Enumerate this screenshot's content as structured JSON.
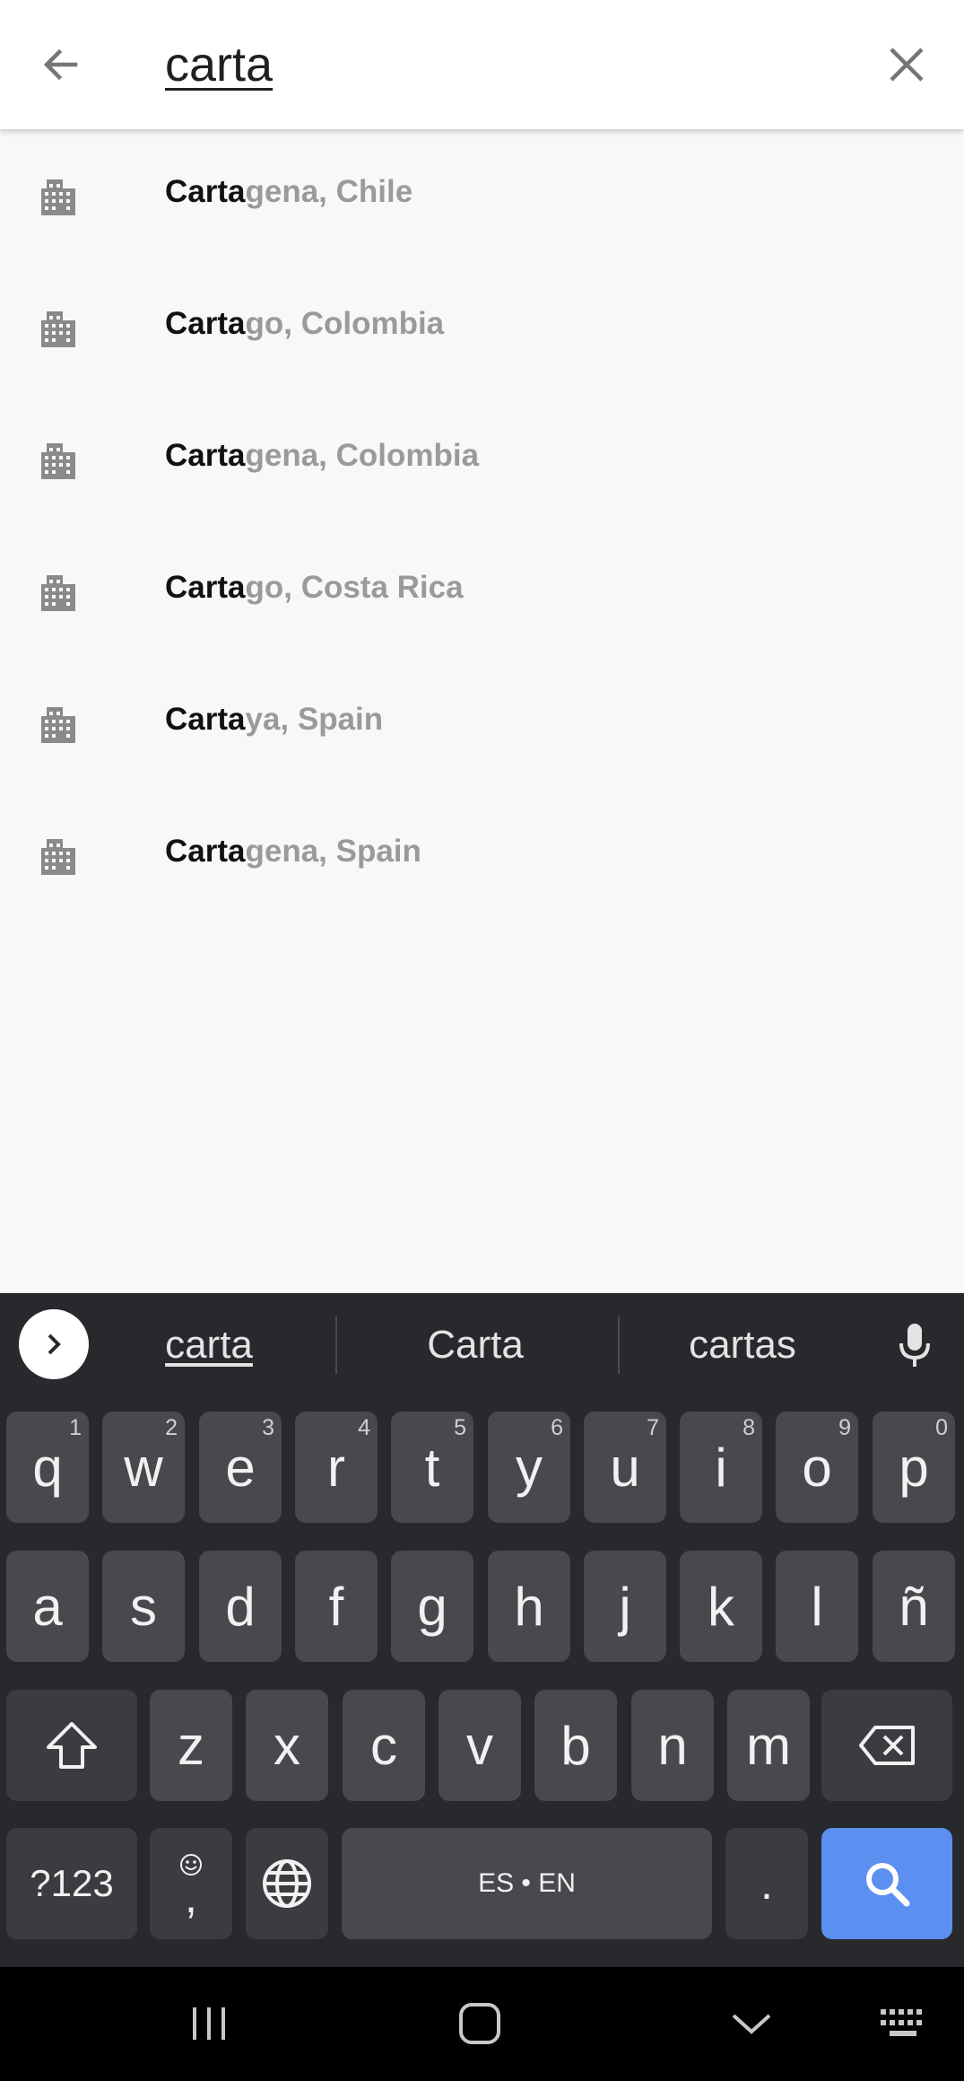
{
  "search": {
    "query": "carta",
    "back_icon": "arrow-left-icon",
    "clear_icon": "close-icon"
  },
  "results": [
    {
      "match": "Carta",
      "rest": "gena, Chile",
      "icon": "city-buildings-icon"
    },
    {
      "match": "Carta",
      "rest": "go, Colombia",
      "icon": "city-buildings-icon"
    },
    {
      "match": "Carta",
      "rest": "gena, Colombia",
      "icon": "city-buildings-icon"
    },
    {
      "match": "Carta",
      "rest": "go, Costa Rica",
      "icon": "city-buildings-icon"
    },
    {
      "match": "Carta",
      "rest": "ya, Spain",
      "icon": "city-buildings-icon"
    },
    {
      "match": "Carta",
      "rest": "gena, Spain",
      "icon": "city-buildings-icon"
    }
  ],
  "keyboard": {
    "suggestions": [
      "carta",
      "Carta",
      "cartas"
    ],
    "row1": [
      {
        "key": "q",
        "hint": "1"
      },
      {
        "key": "w",
        "hint": "2"
      },
      {
        "key": "e",
        "hint": "3"
      },
      {
        "key": "r",
        "hint": "4"
      },
      {
        "key": "t",
        "hint": "5"
      },
      {
        "key": "y",
        "hint": "6"
      },
      {
        "key": "u",
        "hint": "7"
      },
      {
        "key": "i",
        "hint": "8"
      },
      {
        "key": "o",
        "hint": "9"
      },
      {
        "key": "p",
        "hint": "0"
      }
    ],
    "row2": [
      "a",
      "s",
      "d",
      "f",
      "g",
      "h",
      "j",
      "k",
      "l",
      "ñ"
    ],
    "row3": [
      "z",
      "x",
      "c",
      "v",
      "b",
      "n",
      "m"
    ],
    "symbols_label": "?123",
    "comma_label": ",",
    "space_label": "ES • EN",
    "period_label": "."
  },
  "colors": {
    "match_text": "#111111",
    "rest_text": "#9a9a9a",
    "keyboard_bg": "#27292d",
    "key_bg": "#47494d",
    "search_key": "#5b8ff0"
  }
}
